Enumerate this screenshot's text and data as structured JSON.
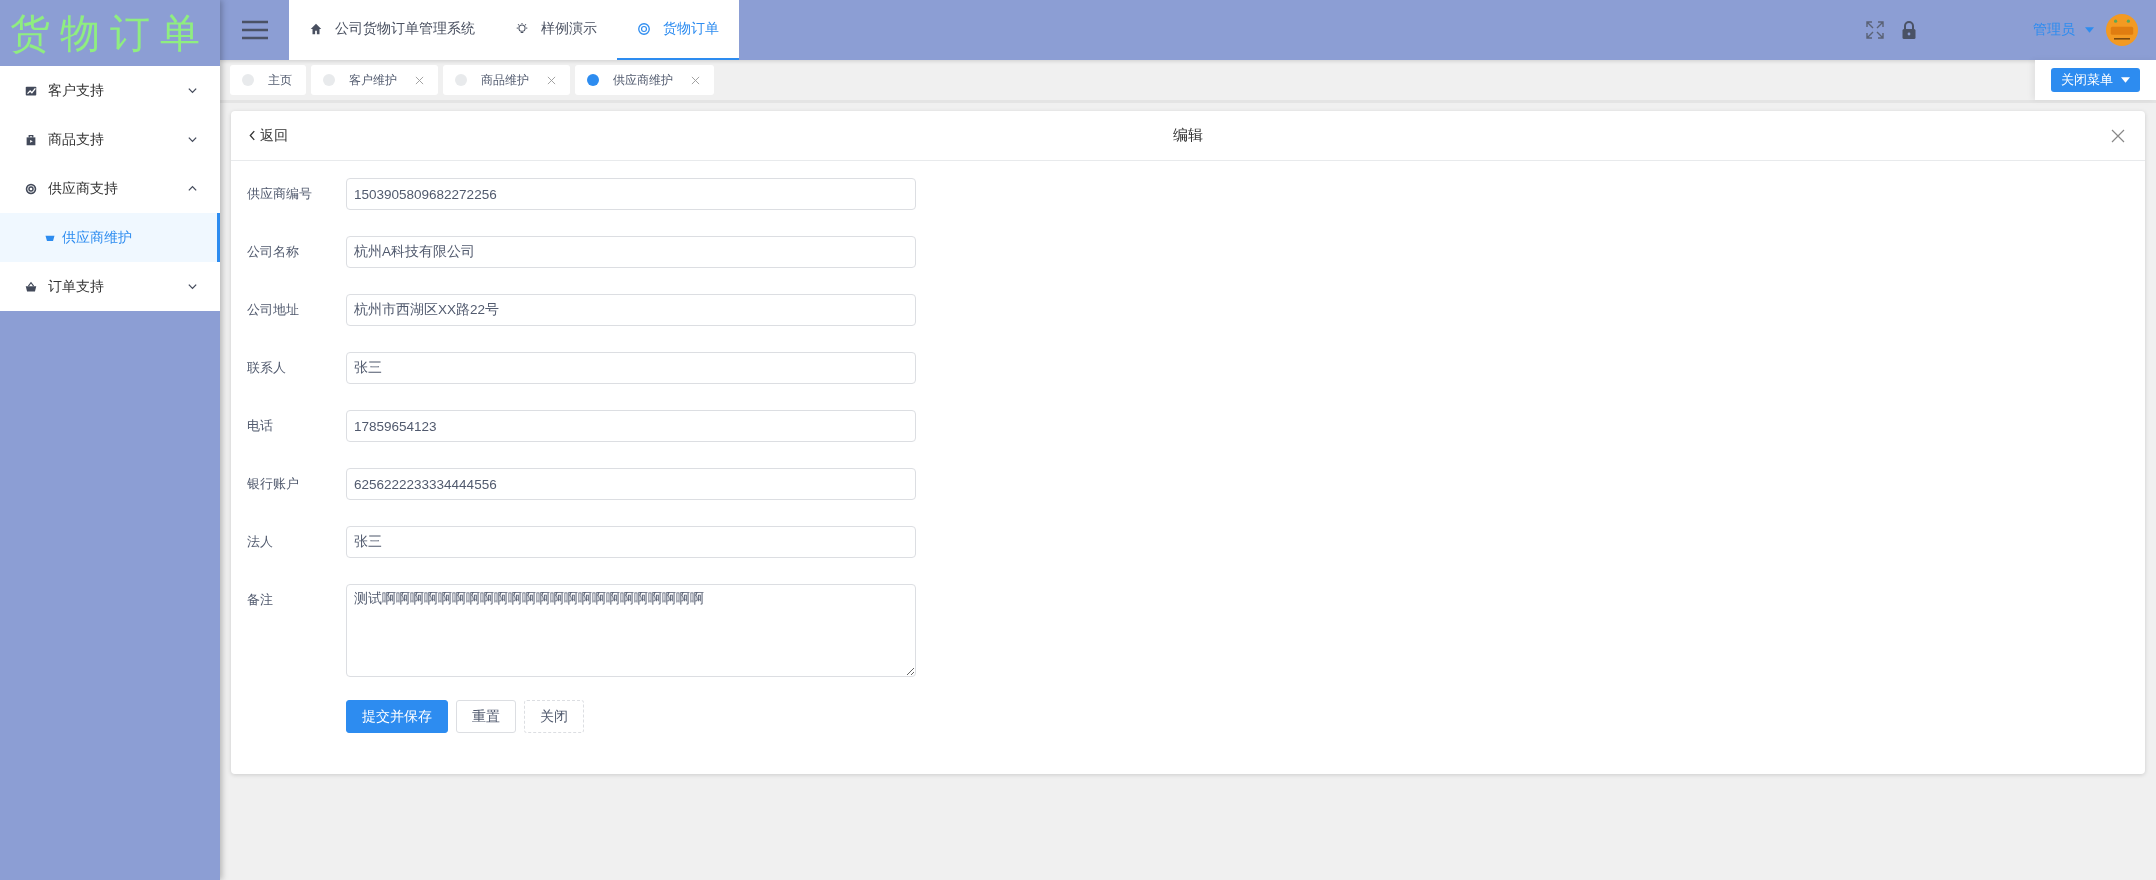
{
  "logo": "货物订单",
  "header_nav": [
    {
      "label": "公司货物订单管理系统",
      "selected": false
    },
    {
      "label": "样例演示",
      "selected": false
    },
    {
      "label": "货物订单",
      "selected": true
    }
  ],
  "user": {
    "name": "管理员"
  },
  "sidebar": {
    "items": [
      {
        "label": "客户支持",
        "expanded": false
      },
      {
        "label": "商品支持",
        "expanded": false
      },
      {
        "label": "供应商支持",
        "expanded": true,
        "children": [
          {
            "label": "供应商维护",
            "selected": true
          }
        ]
      },
      {
        "label": "订单支持",
        "expanded": false
      }
    ]
  },
  "tabs": [
    {
      "label": "主页",
      "selected": false,
      "closable": false
    },
    {
      "label": "客户维护",
      "selected": false,
      "closable": true
    },
    {
      "label": "商品维护",
      "selected": false,
      "closable": true
    },
    {
      "label": "供应商维护",
      "selected": true,
      "closable": true
    }
  ],
  "close_menu_button": "关闭菜单",
  "card": {
    "back": "返回",
    "title": "编辑",
    "fields": [
      {
        "label": "供应商编号",
        "value": "1503905809682272256",
        "kind": "input"
      },
      {
        "label": "公司名称",
        "value": "杭州A科技有限公司",
        "kind": "input"
      },
      {
        "label": "公司地址",
        "value": "杭州市西湖区XX路22号",
        "kind": "input"
      },
      {
        "label": "联系人",
        "value": "张三",
        "kind": "input"
      },
      {
        "label": "电话",
        "value": "17859654123",
        "kind": "input"
      },
      {
        "label": "银行账户",
        "value": "6256222233334444556",
        "kind": "input"
      },
      {
        "label": "法人",
        "value": "张三",
        "kind": "input"
      },
      {
        "label": "备注",
        "value": "测试啊啊啊啊啊啊啊啊啊啊啊啊啊啊啊啊啊啊啊啊啊啊啊",
        "kind": "textarea"
      }
    ],
    "buttons": [
      {
        "label": "提交并保存",
        "kind": "primary"
      },
      {
        "label": "重置",
        "kind": "default"
      },
      {
        "label": "关闭",
        "kind": "dashed"
      }
    ]
  }
}
